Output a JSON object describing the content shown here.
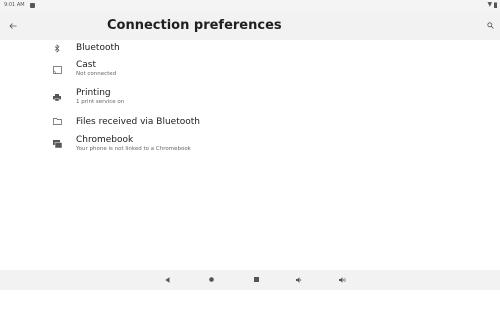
{
  "status_bar": {
    "time": "9:01 AM",
    "notification_icon": "notification-icon",
    "signal": "▼",
    "battery_icon": "battery-icon"
  },
  "toolbar": {
    "back_icon": "arrow-back-icon",
    "title": "Connection preferences",
    "search_icon": "search-icon"
  },
  "list": {
    "items": [
      {
        "icon": "bluetooth-icon",
        "title": "Bluetooth",
        "subtitle": ""
      },
      {
        "icon": "cast-icon",
        "title": "Cast",
        "subtitle": "Not connected"
      },
      {
        "icon": "printer-icon",
        "title": "Printing",
        "subtitle": "1 print service on"
      },
      {
        "icon": "folder-icon",
        "title": "Files received via Bluetooth",
        "subtitle": ""
      },
      {
        "icon": "chromebook-icon",
        "title": "Chromebook",
        "subtitle": "Your phone is not linked to a Chromebook"
      }
    ]
  },
  "nav_bar": {
    "buttons": [
      {
        "icon": "back-triangle-icon"
      },
      {
        "icon": "home-circle-icon"
      },
      {
        "icon": "recents-square-icon"
      },
      {
        "icon": "volume-down-icon"
      },
      {
        "icon": "volume-up-icon"
      }
    ]
  }
}
